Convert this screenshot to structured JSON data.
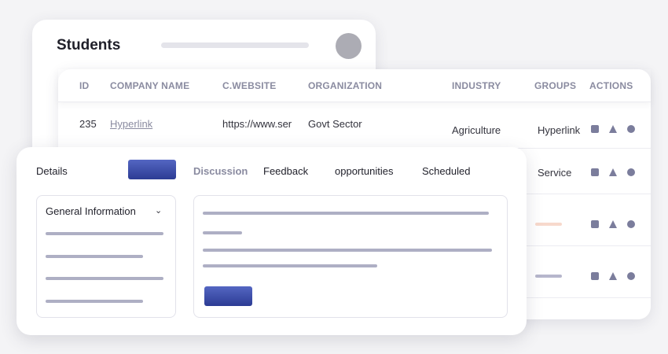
{
  "students": {
    "title": "Students"
  },
  "table": {
    "headers": [
      "ID",
      "COMPANY NAME",
      "C.WEBSITE",
      "ORGANIZATION",
      "INDUSTRY",
      "GROUPS",
      "ACTIONS"
    ],
    "row1": {
      "id": "235",
      "company": "Hyperlink",
      "website": "https://www.ser",
      "organization": "Govt Sector",
      "industry": "Agriculture",
      "group": "Hyperlink"
    },
    "row2": {
      "group": "Service"
    }
  },
  "details": {
    "tabs": [
      "Details",
      "Discussion",
      "Feedback",
      "opportunities",
      "Scheduled"
    ],
    "side_panel_label": "General Information",
    "chevron": "⌄"
  },
  "colors": {
    "accent": "#3a4aa8",
    "icon": "#7b7d9c",
    "placeholder": "#aeafc4",
    "pill_peach": "#f7d9cc",
    "pill_lavender": "#b6b6cc"
  },
  "icons": {
    "action_1": "square-icon",
    "action_2": "triangle-icon",
    "action_3": "circle-icon"
  }
}
